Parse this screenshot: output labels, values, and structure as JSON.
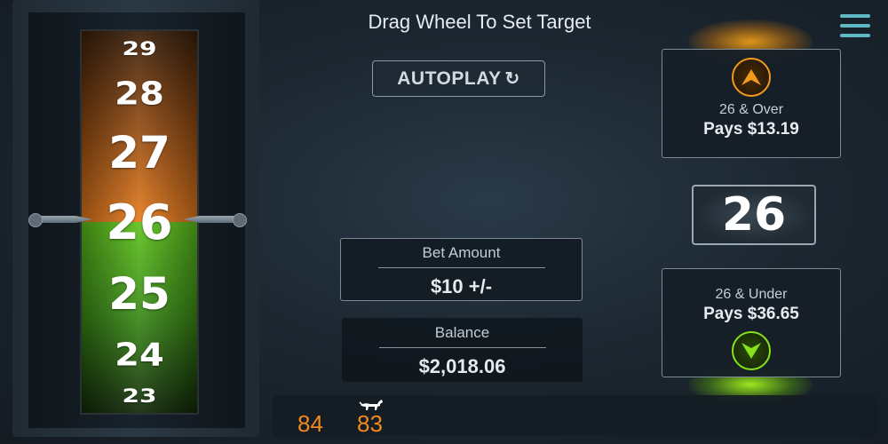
{
  "header": {
    "title": "Drag Wheel To Set Target"
  },
  "wheel": {
    "numbers": [
      "29",
      "28",
      "27",
      "26",
      "25",
      "24",
      "23"
    ],
    "colors": {
      "over": "#e67a1c",
      "under": "#5ec21c"
    }
  },
  "autoplay": {
    "label": "AUTOPLAY",
    "icon": "refresh-icon"
  },
  "over": {
    "label": "26 & Over",
    "pays": "Pays $13.19",
    "icon": "arrow-up-icon",
    "color": "#f29a1a"
  },
  "target": {
    "value": "26"
  },
  "under": {
    "label": "26 & Under",
    "pays": "Pays $36.65",
    "icon": "arrow-down-icon",
    "color": "#86e21a"
  },
  "bet": {
    "label": "Bet Amount",
    "value": "$10 +/-"
  },
  "balance": {
    "label": "Balance",
    "value": "$2,018.06"
  },
  "history": {
    "results": [
      "84",
      "83"
    ],
    "color": "#f08a1e"
  },
  "menu": {
    "icon": "hamburger-menu-icon"
  }
}
